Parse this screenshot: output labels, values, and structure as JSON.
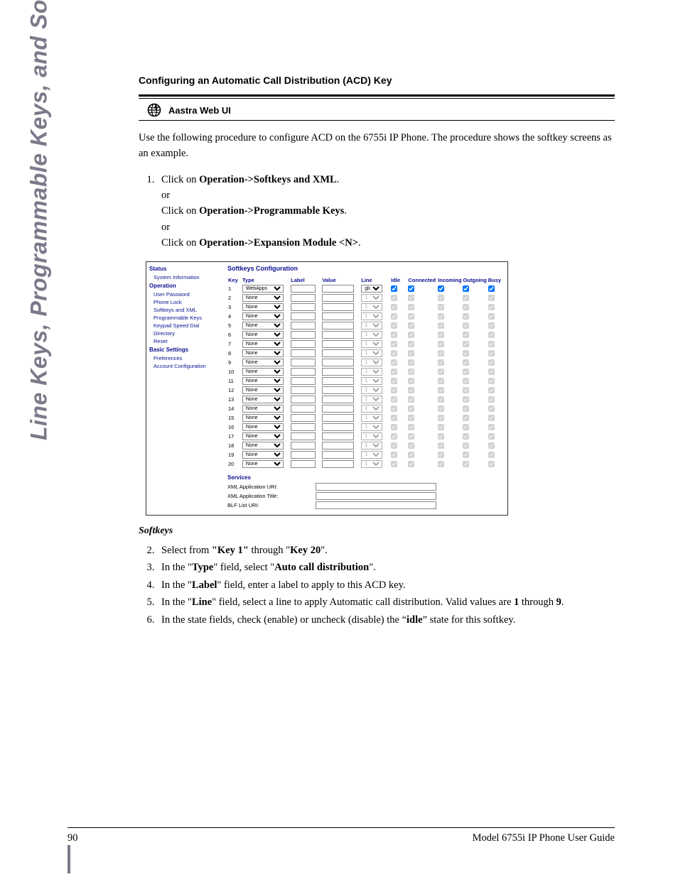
{
  "side_title": "Line Keys, Programmable Keys, and Softkeys",
  "section_title": "Configuring an Automatic Call Distribution (ACD) Key",
  "ui_label": "Aastra Web UI",
  "intro": "Use the following procedure to configure ACD on the 6755i IP Phone. The procedure shows the softkey screens as an example.",
  "step1": {
    "prefix": "Click on ",
    "path1": "Operation->Softkeys and XML",
    "or": "or",
    "path2": "Operation->Programmable Keys",
    "path3": "Operation->Expansion Module <N>"
  },
  "embed": {
    "nav": {
      "status_hdr": "Status",
      "status_items": [
        "System Information"
      ],
      "operation_hdr": "Operation",
      "operation_items": [
        "User Password",
        "Phone Lock",
        "Softkeys and XML",
        "Programmable Keys",
        "Keypad Speed Dial",
        "Directory",
        "Reset"
      ],
      "basic_hdr": "Basic Settings",
      "basic_items": [
        "Preferences",
        "Account Configuration"
      ]
    },
    "title": "Softkeys Configuration",
    "headers": [
      "Key",
      "Type",
      "Label",
      "Value",
      "Line",
      "Idle",
      "Connected",
      "Incoming",
      "Outgoing",
      "Busy"
    ],
    "rows": [
      {
        "key": "1",
        "type": "WebApps",
        "line": "global",
        "enabled": true
      },
      {
        "key": "2",
        "type": "None",
        "line": "1",
        "enabled": false
      },
      {
        "key": "3",
        "type": "None",
        "line": "1",
        "enabled": false
      },
      {
        "key": "4",
        "type": "None",
        "line": "1",
        "enabled": false
      },
      {
        "key": "5",
        "type": "None",
        "line": "1",
        "enabled": false
      },
      {
        "key": "6",
        "type": "None",
        "line": "1",
        "enabled": false
      },
      {
        "key": "7",
        "type": "None",
        "line": "1",
        "enabled": false
      },
      {
        "key": "8",
        "type": "None",
        "line": "1",
        "enabled": false
      },
      {
        "key": "9",
        "type": "None",
        "line": "1",
        "enabled": false
      },
      {
        "key": "10",
        "type": "None",
        "line": "1",
        "enabled": false
      },
      {
        "key": "11",
        "type": "None",
        "line": "1",
        "enabled": false
      },
      {
        "key": "12",
        "type": "None",
        "line": "1",
        "enabled": false
      },
      {
        "key": "13",
        "type": "None",
        "line": "1",
        "enabled": false
      },
      {
        "key": "14",
        "type": "None",
        "line": "1",
        "enabled": false
      },
      {
        "key": "15",
        "type": "None",
        "line": "1",
        "enabled": false
      },
      {
        "key": "16",
        "type": "None",
        "line": "1",
        "enabled": false
      },
      {
        "key": "17",
        "type": "None",
        "line": "1",
        "enabled": false
      },
      {
        "key": "18",
        "type": "None",
        "line": "1",
        "enabled": false
      },
      {
        "key": "19",
        "type": "None",
        "line": "1",
        "enabled": false
      },
      {
        "key": "20",
        "type": "None",
        "line": "1",
        "enabled": false
      }
    ],
    "services_hdr": "Services",
    "services": [
      {
        "label": "XML Application URI:",
        "value": ""
      },
      {
        "label": "XML Application Title:",
        "value": ""
      },
      {
        "label": "BLF List URI:",
        "value": ""
      }
    ]
  },
  "softkeys_sub": "Softkeys",
  "step2": {
    "a": "Select from ",
    "b": "\"Key 1\"",
    "c": " through \"",
    "d": "Key 20",
    "e": "\"."
  },
  "step3": {
    "a": "In the \"",
    "b": "Type",
    "c": "\" field, select \"",
    "d": "Auto call distribution",
    "e": "\"."
  },
  "step4": {
    "a": "In the \"",
    "b": "Label",
    "c": "\" field, enter a label to apply to this ACD key."
  },
  "step5": {
    "a": "In the \"",
    "b": "Line",
    "c": "\" field, select a line to apply Automatic call distribution. Valid values are ",
    "d": "1",
    "e": " through ",
    "f": "9",
    "g": "."
  },
  "step6": {
    "a": "In the state fields, check (enable) or uncheck (disable) the “",
    "b": "idle",
    "c": "” state for this softkey."
  },
  "footer": {
    "page": "90",
    "title": "Model 6755i IP Phone User Guide"
  }
}
